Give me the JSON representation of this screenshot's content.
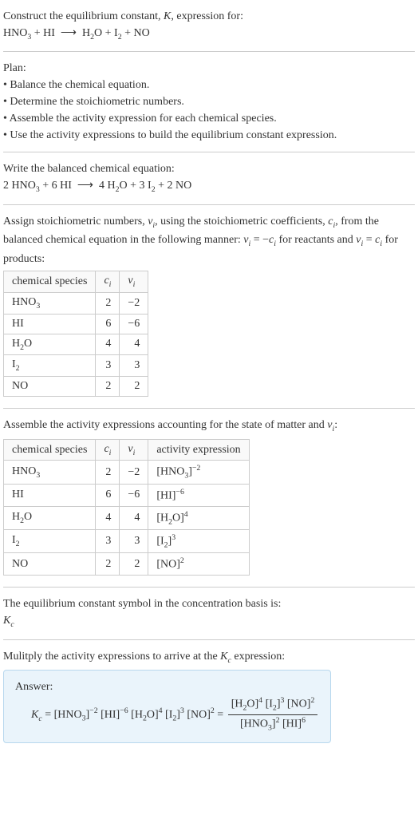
{
  "header": {
    "prompt": "Construct the equilibrium constant, K, expression for:",
    "equation": "HNO₃ + HI ⟶ H₂O + I₂ + NO"
  },
  "plan": {
    "title": "Plan:",
    "steps": [
      "• Balance the chemical equation.",
      "• Determine the stoichiometric numbers.",
      "• Assemble the activity expression for each chemical species.",
      "• Use the activity expressions to build the equilibrium constant expression."
    ]
  },
  "balanced": {
    "title": "Write the balanced chemical equation:",
    "equation": "2 HNO₃ + 6 HI ⟶ 4 H₂O + 3 I₂ + 2 NO"
  },
  "stoich": {
    "intro_a": "Assign stoichiometric numbers, νᵢ, using the stoichiometric coefficients, cᵢ, from the balanced chemical equation in the following manner: νᵢ = −cᵢ for reactants and νᵢ = cᵢ for products:",
    "headers": {
      "species": "chemical species",
      "c": "cᵢ",
      "v": "νᵢ"
    },
    "rows": [
      {
        "species": "HNO₃",
        "c": "2",
        "v": "−2"
      },
      {
        "species": "HI",
        "c": "6",
        "v": "−6"
      },
      {
        "species": "H₂O",
        "c": "4",
        "v": "4"
      },
      {
        "species": "I₂",
        "c": "3",
        "v": "3"
      },
      {
        "species": "NO",
        "c": "2",
        "v": "2"
      }
    ]
  },
  "activity": {
    "intro": "Assemble the activity expressions accounting for the state of matter and νᵢ:",
    "headers": {
      "species": "chemical species",
      "c": "cᵢ",
      "v": "νᵢ",
      "expr": "activity expression"
    },
    "rows": [
      {
        "species": "HNO₃",
        "c": "2",
        "v": "−2",
        "expr": "[HNO₃]⁻²"
      },
      {
        "species": "HI",
        "c": "6",
        "v": "−6",
        "expr": "[HI]⁻⁶"
      },
      {
        "species": "H₂O",
        "c": "4",
        "v": "4",
        "expr": "[H₂O]⁴"
      },
      {
        "species": "I₂",
        "c": "3",
        "v": "3",
        "expr": "[I₂]³"
      },
      {
        "species": "NO",
        "c": "2",
        "v": "2",
        "expr": "[NO]²"
      }
    ]
  },
  "symbol": {
    "text": "The equilibrium constant symbol in the concentration basis is:",
    "sym": "K꜀"
  },
  "final": {
    "intro": "Mulitply the activity expressions to arrive at the K꜀ expression:",
    "answer_label": "Answer:",
    "lhs": "K꜀ = [HNO₃]⁻² [HI]⁻⁶ [H₂O]⁴ [I₂]³ [NO]² = ",
    "frac_num": "[H₂O]⁴ [I₂]³ [NO]²",
    "frac_den": "[HNO₃]² [HI]⁶"
  }
}
